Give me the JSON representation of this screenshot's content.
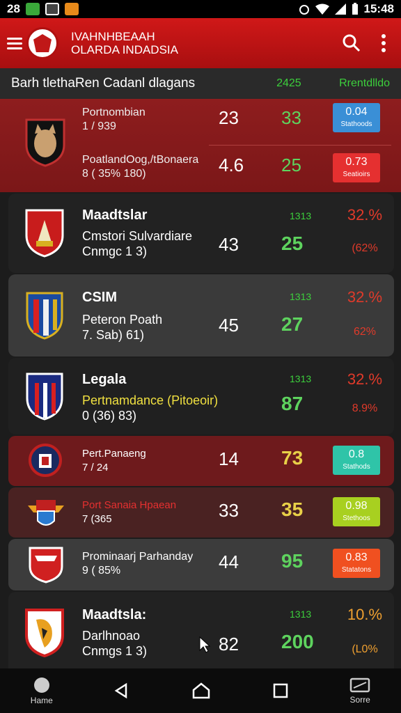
{
  "status_bar": {
    "time_left": "28",
    "time_right": "15:48"
  },
  "app_bar": {
    "title_line1": "IVAHNHBEAAH",
    "title_line2": "OLARDA INDADSIA"
  },
  "sub_header": {
    "title": "Barh tlethaRen Cadanl dlagans",
    "col1": "2425",
    "col2": "Rrentdlldo"
  },
  "featured": [
    {
      "team_line1": "Portnombian",
      "team_line2": "1 / 939",
      "score1": "23",
      "score2": "33",
      "badge_value": "0.04",
      "badge_label": "Stathoods",
      "badge_color": "#3a8fd6"
    },
    {
      "team_line1": "PoatlandOog,/tBonaera",
      "team_line2": "8 ( 35% 180)",
      "score1": "4.6",
      "score2": "25",
      "badge_value": "0.73",
      "badge_label": "Seatioirs",
      "badge_color": "#e53030"
    }
  ],
  "cards": [
    {
      "name": "Maadtslar",
      "sub1": "Cmstori Sulvardiare",
      "sub2": "Cnmgc 1 3)",
      "v1": "43",
      "v2": "25",
      "small": "1313",
      "pct": "32.%",
      "pct_sub": "(62%",
      "sub1_color": "#ffffff",
      "v2_color": "#5ed35e",
      "pct_color": "#e03a2a"
    },
    {
      "name": "CSIM",
      "sub1": "Peteron Poath",
      "sub2": "7. Sab) 61)",
      "v1": "45",
      "v2": "27",
      "small": "1313",
      "pct": "32.%",
      "pct_sub": "62%",
      "sub1_color": "#ffffff",
      "v2_color": "#5ed35e",
      "pct_color": "#e03a2a"
    },
    {
      "name": "Legala",
      "sub1": "Pertnamdance (Pitoeoir)",
      "sub2": "0 (36) 83)",
      "v1": "",
      "v2": "87",
      "small": "1313",
      "pct": "32.%",
      "pct_sub": "8.9%",
      "sub1_color": "#f0e040",
      "v2_color": "#5ed35e",
      "pct_color": "#e03a2a"
    },
    {
      "name": "Maadtsla:",
      "sub1": "Darlhnoao",
      "sub2": "Cnmgs 1 3)",
      "v1": "82",
      "v2": "200",
      "small": "1313",
      "pct": "10.%",
      "pct_sub": "(L0%",
      "sub1_color": "#ffffff",
      "v2_color": "#5ed35e",
      "pct_color": "#f0a030"
    }
  ],
  "rows": [
    {
      "team_line1": "Pert.Panaeng",
      "team_line2": "7 / 24",
      "score1": "14",
      "score2": "73",
      "badge_value": "0.8",
      "badge_label": "Stathods",
      "badge_color": "#2fc4a8",
      "score2_color": "#e8d048",
      "name_color": "#ffffff"
    },
    {
      "team_line1": "Port Sanaia Hpaean",
      "team_line2": "7 (365",
      "score1": "33",
      "score2": "35",
      "badge_value": "0.98",
      "badge_label": "Stethoos",
      "badge_color": "#a8d020",
      "score2_color": "#e8d048",
      "name_color": "#e53030"
    },
    {
      "team_line1": "Prominaarj Parhanday",
      "team_line2": "9 ( 85%",
      "score1": "44",
      "score2": "95",
      "badge_value": "0.83",
      "badge_label": "Statatons",
      "badge_color": "#f05020",
      "score2_color": "#5ed35e",
      "name_color": "#ffffff"
    }
  ],
  "nav": {
    "home": "Hame",
    "score": "Sorre"
  }
}
